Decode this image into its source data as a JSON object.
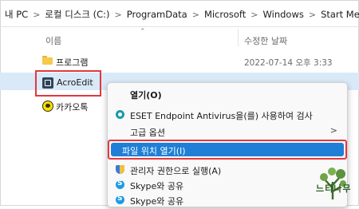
{
  "breadcrumb": {
    "items": [
      "내 PC",
      "로컬 디스크 (C:)",
      "ProgramData",
      "Microsoft",
      "Windows",
      "Start Menu"
    ],
    "separator": ">"
  },
  "columns": {
    "name": "이름",
    "date": "수정한 날짜",
    "sort_icon": "chevron-up-icon"
  },
  "files": [
    {
      "name": "프로그램",
      "date": "2022-07-14 오후 3:33",
      "icon": "folder-icon"
    },
    {
      "name": "AcroEdit",
      "date": "",
      "icon": "app-icon"
    },
    {
      "name": "카카오톡",
      "date": "",
      "icon": "kakaotalk-icon"
    }
  ],
  "context_menu": {
    "items": [
      {
        "label": "열기(O)"
      },
      {
        "label": "ESET Endpoint Antivirus을(를) 사용하여 검사",
        "icon": "eset-icon"
      },
      {
        "label": "고급 옵션",
        "submenu_icon": ">"
      },
      {
        "label": "파일 위치 열기(I)"
      },
      {
        "label": "관리자 권한으로 실행(A)",
        "icon": "shield-icon"
      },
      {
        "label": "Skype와 공유",
        "icon": "skype-icon"
      },
      {
        "label": "Skype와 공유",
        "icon": "skype-icon"
      }
    ]
  },
  "colors": {
    "selection": "#d9e9f8",
    "highlight": "#1f7fd6",
    "annotation": "#e0393e"
  },
  "watermark": {
    "text": "느티나무"
  }
}
